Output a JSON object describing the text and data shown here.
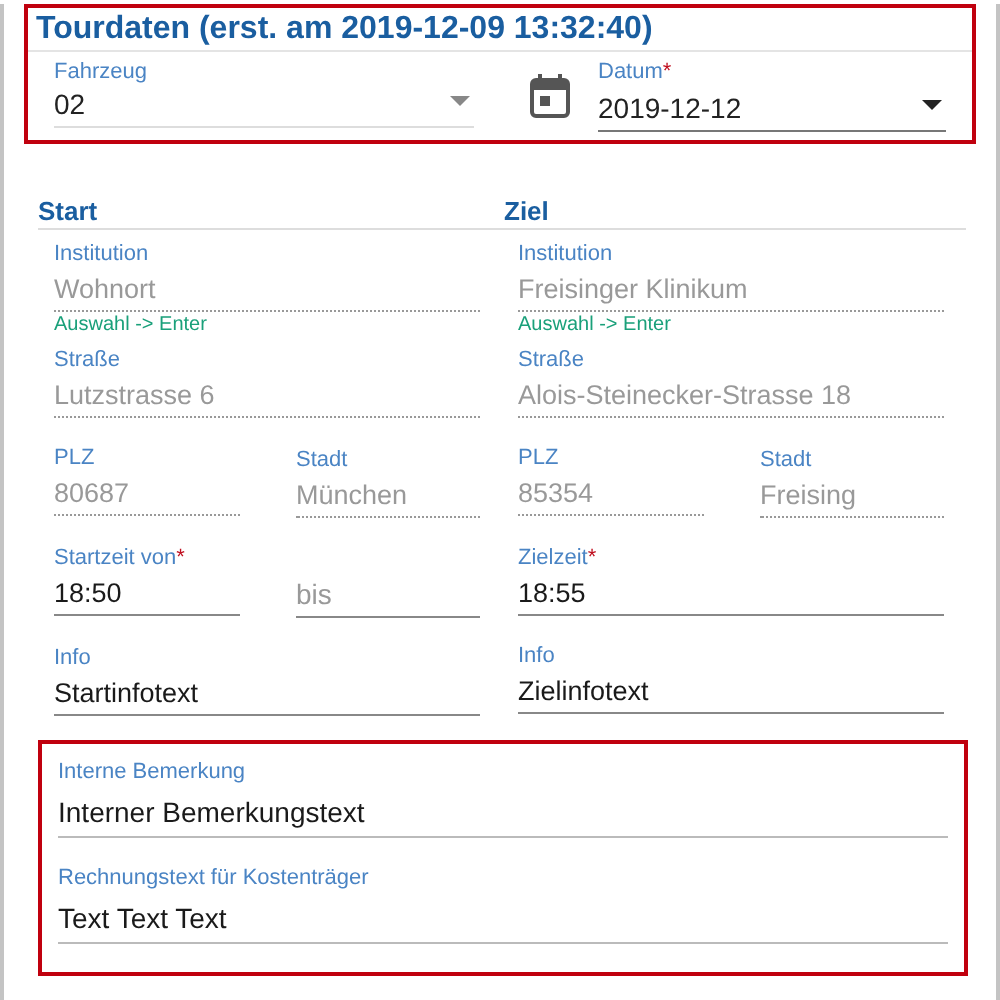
{
  "header": {
    "title": "Tourdaten (erst. am 2019-12-09 13:32:40)"
  },
  "top_fields": [
    {
      "kind": "select",
      "label": "Fahrzeug",
      "value": "02"
    },
    {
      "kind": "date",
      "label": "Datum",
      "value": "2019-12-12",
      "required_mark": "*"
    }
  ],
  "sections": [
    {
      "title": "Start",
      "rows": [
        [
          {
            "label": "Institution",
            "value": "Wohnort",
            "disabled": true,
            "hint": "Auswahl -> Enter"
          }
        ],
        [
          {
            "label": "Straße",
            "value": "Lutzstrasse 6",
            "disabled": true
          }
        ],
        [
          {
            "label": "PLZ",
            "value": "80687",
            "disabled": true
          },
          {
            "label": "Stadt",
            "value": "München",
            "disabled": true
          }
        ],
        [
          {
            "label": "Startzeit von",
            "value": "18:50",
            "disabled": false,
            "required_mark": "*"
          },
          {
            "placeholder": "bis",
            "disabled": false
          }
        ],
        [
          {
            "label": "Info",
            "value": "Startinfotext",
            "disabled": false
          }
        ]
      ]
    },
    {
      "title": "Ziel",
      "rows": [
        [
          {
            "label": "Institution",
            "value": "Freisinger Klinikum",
            "disabled": true,
            "hint": "Auswahl -> Enter"
          }
        ],
        [
          {
            "label": "Straße",
            "value": "Alois-Steinecker-Strasse 18",
            "disabled": true
          }
        ],
        [
          {
            "label": "PLZ",
            "value": "85354",
            "disabled": true
          },
          {
            "label": "Stadt",
            "value": "Freising",
            "disabled": true
          }
        ],
        [
          {
            "label": "Zielzeit",
            "value": "18:55",
            "disabled": false,
            "required_mark": "*"
          }
        ],
        [
          {
            "label": "Info",
            "value": "Zielinfotext",
            "disabled": false
          }
        ]
      ]
    }
  ],
  "remarks": [
    {
      "label": "Interne Bemerkung",
      "value": "Interner Bemerkungstext"
    },
    {
      "label": "Rechnungstext für Kostenträger",
      "value": "Text Text Text"
    }
  ]
}
